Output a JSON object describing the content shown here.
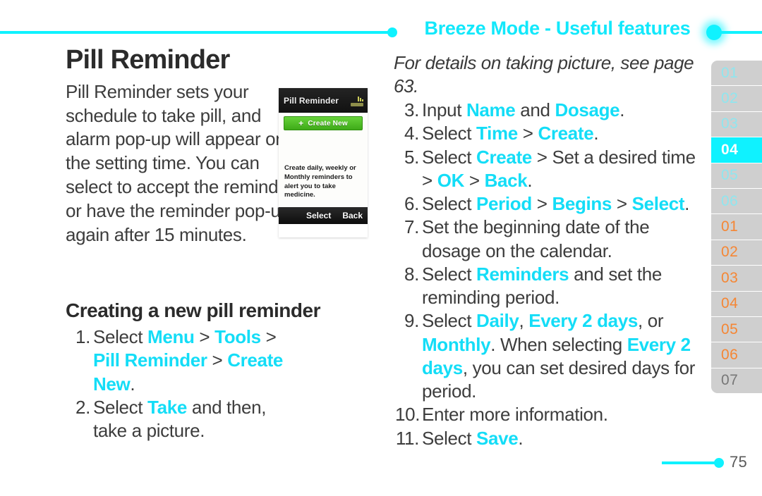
{
  "header": {
    "title": "Breeze Mode - Useful features",
    "accent_color": "#0ff2ff"
  },
  "left": {
    "page_title": "Pill Reminder",
    "intro_paragraph": "Pill Reminder sets your schedule to take pill, and alarm pop-up will appear on the setting time. You can select to accept the reminder or have the reminder pop-up again after 15 minutes.",
    "section_heading": "Creating a new pill reminder",
    "steps": [
      {
        "num": "1.",
        "parts": [
          {
            "t": "Select ",
            "hl": false
          },
          {
            "t": "Menu",
            "hl": true
          },
          {
            "t": " > ",
            "hl": false
          },
          {
            "t": "Tools",
            "hl": true
          },
          {
            "t": " > ",
            "hl": false
          },
          {
            "t": "Pill Reminder",
            "hl": true
          },
          {
            "t": " > ",
            "hl": false
          },
          {
            "t": "Create New",
            "hl": true
          },
          {
            "t": ".",
            "hl": false
          }
        ]
      },
      {
        "num": "2.",
        "parts": [
          {
            "t": "Select ",
            "hl": false
          },
          {
            "t": "Take",
            "hl": true
          },
          {
            "t": " and then, take a picture.",
            "hl": false
          }
        ]
      }
    ]
  },
  "phone_screenshot": {
    "title": "Pill Reminder",
    "create_new_label": "Create New",
    "plus_glyph": "+",
    "description": "Create daily, weekly or Monthly reminders to alert you to take medicine.",
    "softkey_left": "Select",
    "softkey_right": "Back"
  },
  "right": {
    "note": "For details on taking picture, see page 63.",
    "steps": [
      {
        "num": "3.",
        "parts": [
          {
            "t": "Input ",
            "hl": false
          },
          {
            "t": "Name",
            "hl": true
          },
          {
            "t": " and ",
            "hl": false
          },
          {
            "t": "Dosage",
            "hl": true
          },
          {
            "t": ".",
            "hl": false
          }
        ]
      },
      {
        "num": "4.",
        "parts": [
          {
            "t": "Select ",
            "hl": false
          },
          {
            "t": "Time",
            "hl": true
          },
          {
            "t": " > ",
            "hl": false
          },
          {
            "t": "Create",
            "hl": true
          },
          {
            "t": ".",
            "hl": false
          }
        ]
      },
      {
        "num": "5.",
        "parts": [
          {
            "t": "Select ",
            "hl": false
          },
          {
            "t": "Create",
            "hl": true
          },
          {
            "t": " > Set a desired time > ",
            "hl": false
          },
          {
            "t": "OK",
            "hl": true
          },
          {
            "t": " > ",
            "hl": false
          },
          {
            "t": "Back",
            "hl": true
          },
          {
            "t": ".",
            "hl": false
          }
        ]
      },
      {
        "num": "6.",
        "parts": [
          {
            "t": "Select ",
            "hl": false
          },
          {
            "t": "Period",
            "hl": true
          },
          {
            "t": " > ",
            "hl": false
          },
          {
            "t": "Begins",
            "hl": true
          },
          {
            "t": " > ",
            "hl": false
          },
          {
            "t": "Select",
            "hl": true
          },
          {
            "t": ".",
            "hl": false
          }
        ]
      },
      {
        "num": "7.",
        "parts": [
          {
            "t": "Set the beginning date of the dosage on the calendar.",
            "hl": false
          }
        ]
      },
      {
        "num": "8.",
        "parts": [
          {
            "t": "Select ",
            "hl": false
          },
          {
            "t": "Reminders",
            "hl": true
          },
          {
            "t": " and set the reminding period.",
            "hl": false
          }
        ]
      },
      {
        "num": "9.",
        "parts": [
          {
            "t": "Select ",
            "hl": false
          },
          {
            "t": "Daily",
            "hl": true
          },
          {
            "t": ", ",
            "hl": false
          },
          {
            "t": "Every 2 days",
            "hl": true
          },
          {
            "t": ", or ",
            "hl": false
          },
          {
            "t": "Monthly",
            "hl": true
          },
          {
            "t": ". When selecting ",
            "hl": false
          },
          {
            "t": "Every 2 days",
            "hl": true
          },
          {
            "t": ", you can set desired days for period.",
            "hl": false
          }
        ]
      },
      {
        "num": "10.",
        "parts": [
          {
            "t": "Enter more information.",
            "hl": false
          }
        ]
      },
      {
        "num": "11.",
        "parts": [
          {
            "t": "Select ",
            "hl": false
          },
          {
            "t": "Save",
            "hl": true
          },
          {
            "t": ".",
            "hl": false
          }
        ]
      }
    ]
  },
  "tab_rail": [
    {
      "label": "01",
      "style": "cyan",
      "active": false
    },
    {
      "label": "02",
      "style": "cyan",
      "active": false
    },
    {
      "label": "03",
      "style": "cyan",
      "active": false
    },
    {
      "label": "04",
      "style": "cyan",
      "active": true
    },
    {
      "label": "05",
      "style": "cyan",
      "active": false
    },
    {
      "label": "06",
      "style": "cyan",
      "active": false
    },
    {
      "label": "01",
      "style": "orange",
      "active": false
    },
    {
      "label": "02",
      "style": "orange",
      "active": false
    },
    {
      "label": "03",
      "style": "orange",
      "active": false
    },
    {
      "label": "04",
      "style": "orange",
      "active": false
    },
    {
      "label": "05",
      "style": "orange",
      "active": false
    },
    {
      "label": "06",
      "style": "orange",
      "active": false
    },
    {
      "label": "07",
      "style": "gray",
      "active": false
    }
  ],
  "footer": {
    "page_number": "75"
  }
}
